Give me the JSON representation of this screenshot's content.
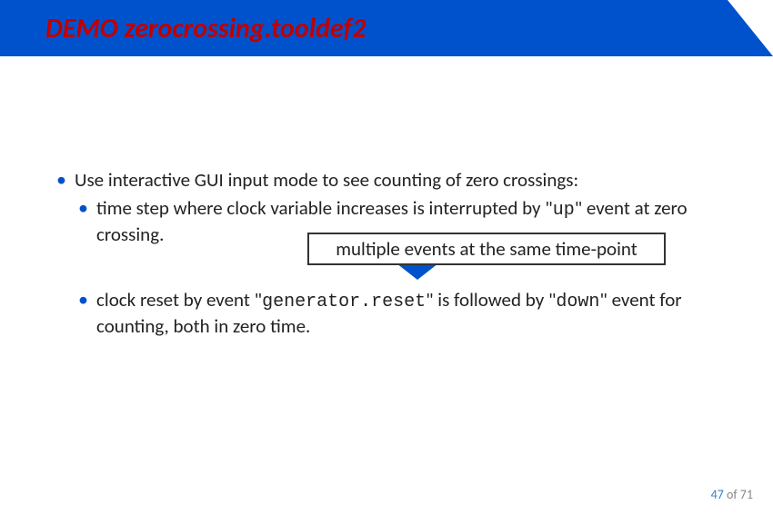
{
  "title": "DEMO zerocrossing.tooldef2",
  "bullets": {
    "b1": "Use interactive GUI input mode to see counting of zero crossings:",
    "b2a_prefix": "time step where clock variable increases is interrupted by \"",
    "b2a_mono": "up",
    "b2a_suffix": "\" event at zero crossing.",
    "b2b_prefix": "clock reset by event \"",
    "b2b_mono1": "generator.reset",
    "b2b_mid": "\" is followed by \"",
    "b2b_mono2": "down",
    "b2b_suffix": "\" event for counting, both in zero time."
  },
  "callout": "multiple events at the same time-point",
  "footer": {
    "current": "47",
    "of": " of ",
    "total": "71"
  }
}
